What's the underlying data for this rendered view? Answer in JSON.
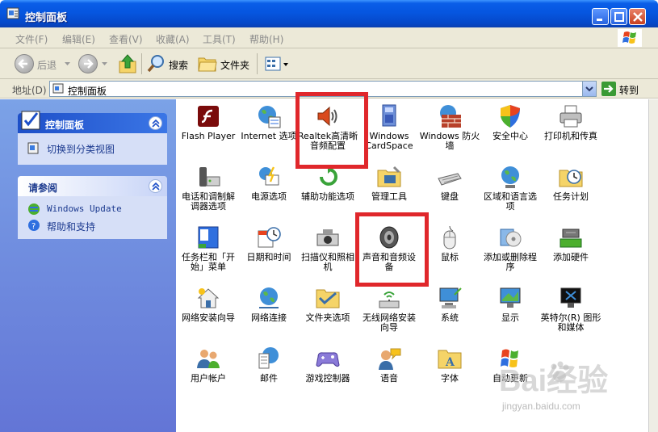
{
  "window": {
    "title": "控制面板"
  },
  "menu": [
    "文件(F)",
    "编辑(E)",
    "查看(V)",
    "收藏(A)",
    "工具(T)",
    "帮助(H)"
  ],
  "toolbar": {
    "back": "后退",
    "search": "搜索",
    "folders": "文件夹"
  },
  "address": {
    "label": "地址(D)",
    "value": "控制面板",
    "go": "转到"
  },
  "leftpane": {
    "panel_title": "控制面板",
    "switch_view": "切换到分类视图",
    "see_also_title": "请参阅",
    "see_also": [
      "Windows Update",
      "帮助和支持"
    ]
  },
  "items": [
    [
      "Flash Player",
      "Internet 选项",
      "Realtek高清晰音频配置",
      "Windows CardSpace",
      "Windows 防火墙",
      "安全中心",
      "打印机和传真"
    ],
    [
      "电话和调制解调器选项",
      "电源选项",
      "辅助功能选项",
      "管理工具",
      "键盘",
      "区域和语言选项",
      "任务计划"
    ],
    [
      "任务栏和「开始」菜单",
      "日期和时间",
      "扫描仪和照相机",
      "声音和音频设备",
      "鼠标",
      "添加或删除程序",
      "添加硬件"
    ],
    [
      "网络安装向导",
      "网络连接",
      "文件夹选项",
      "无线网络安装向导",
      "系统",
      "显示",
      "英特尔(R) 图形和媒体"
    ],
    [
      "用户帐户",
      "邮件",
      "游戏控制器",
      "语音",
      "字体",
      "自动更新"
    ]
  ],
  "watermark": {
    "brand": "Bai经验",
    "url": "jingyan.baidu.com"
  },
  "colors": {
    "title_bar": "#0656e0",
    "task_pane": "#7ba2e7",
    "highlight": "#e0272b"
  }
}
